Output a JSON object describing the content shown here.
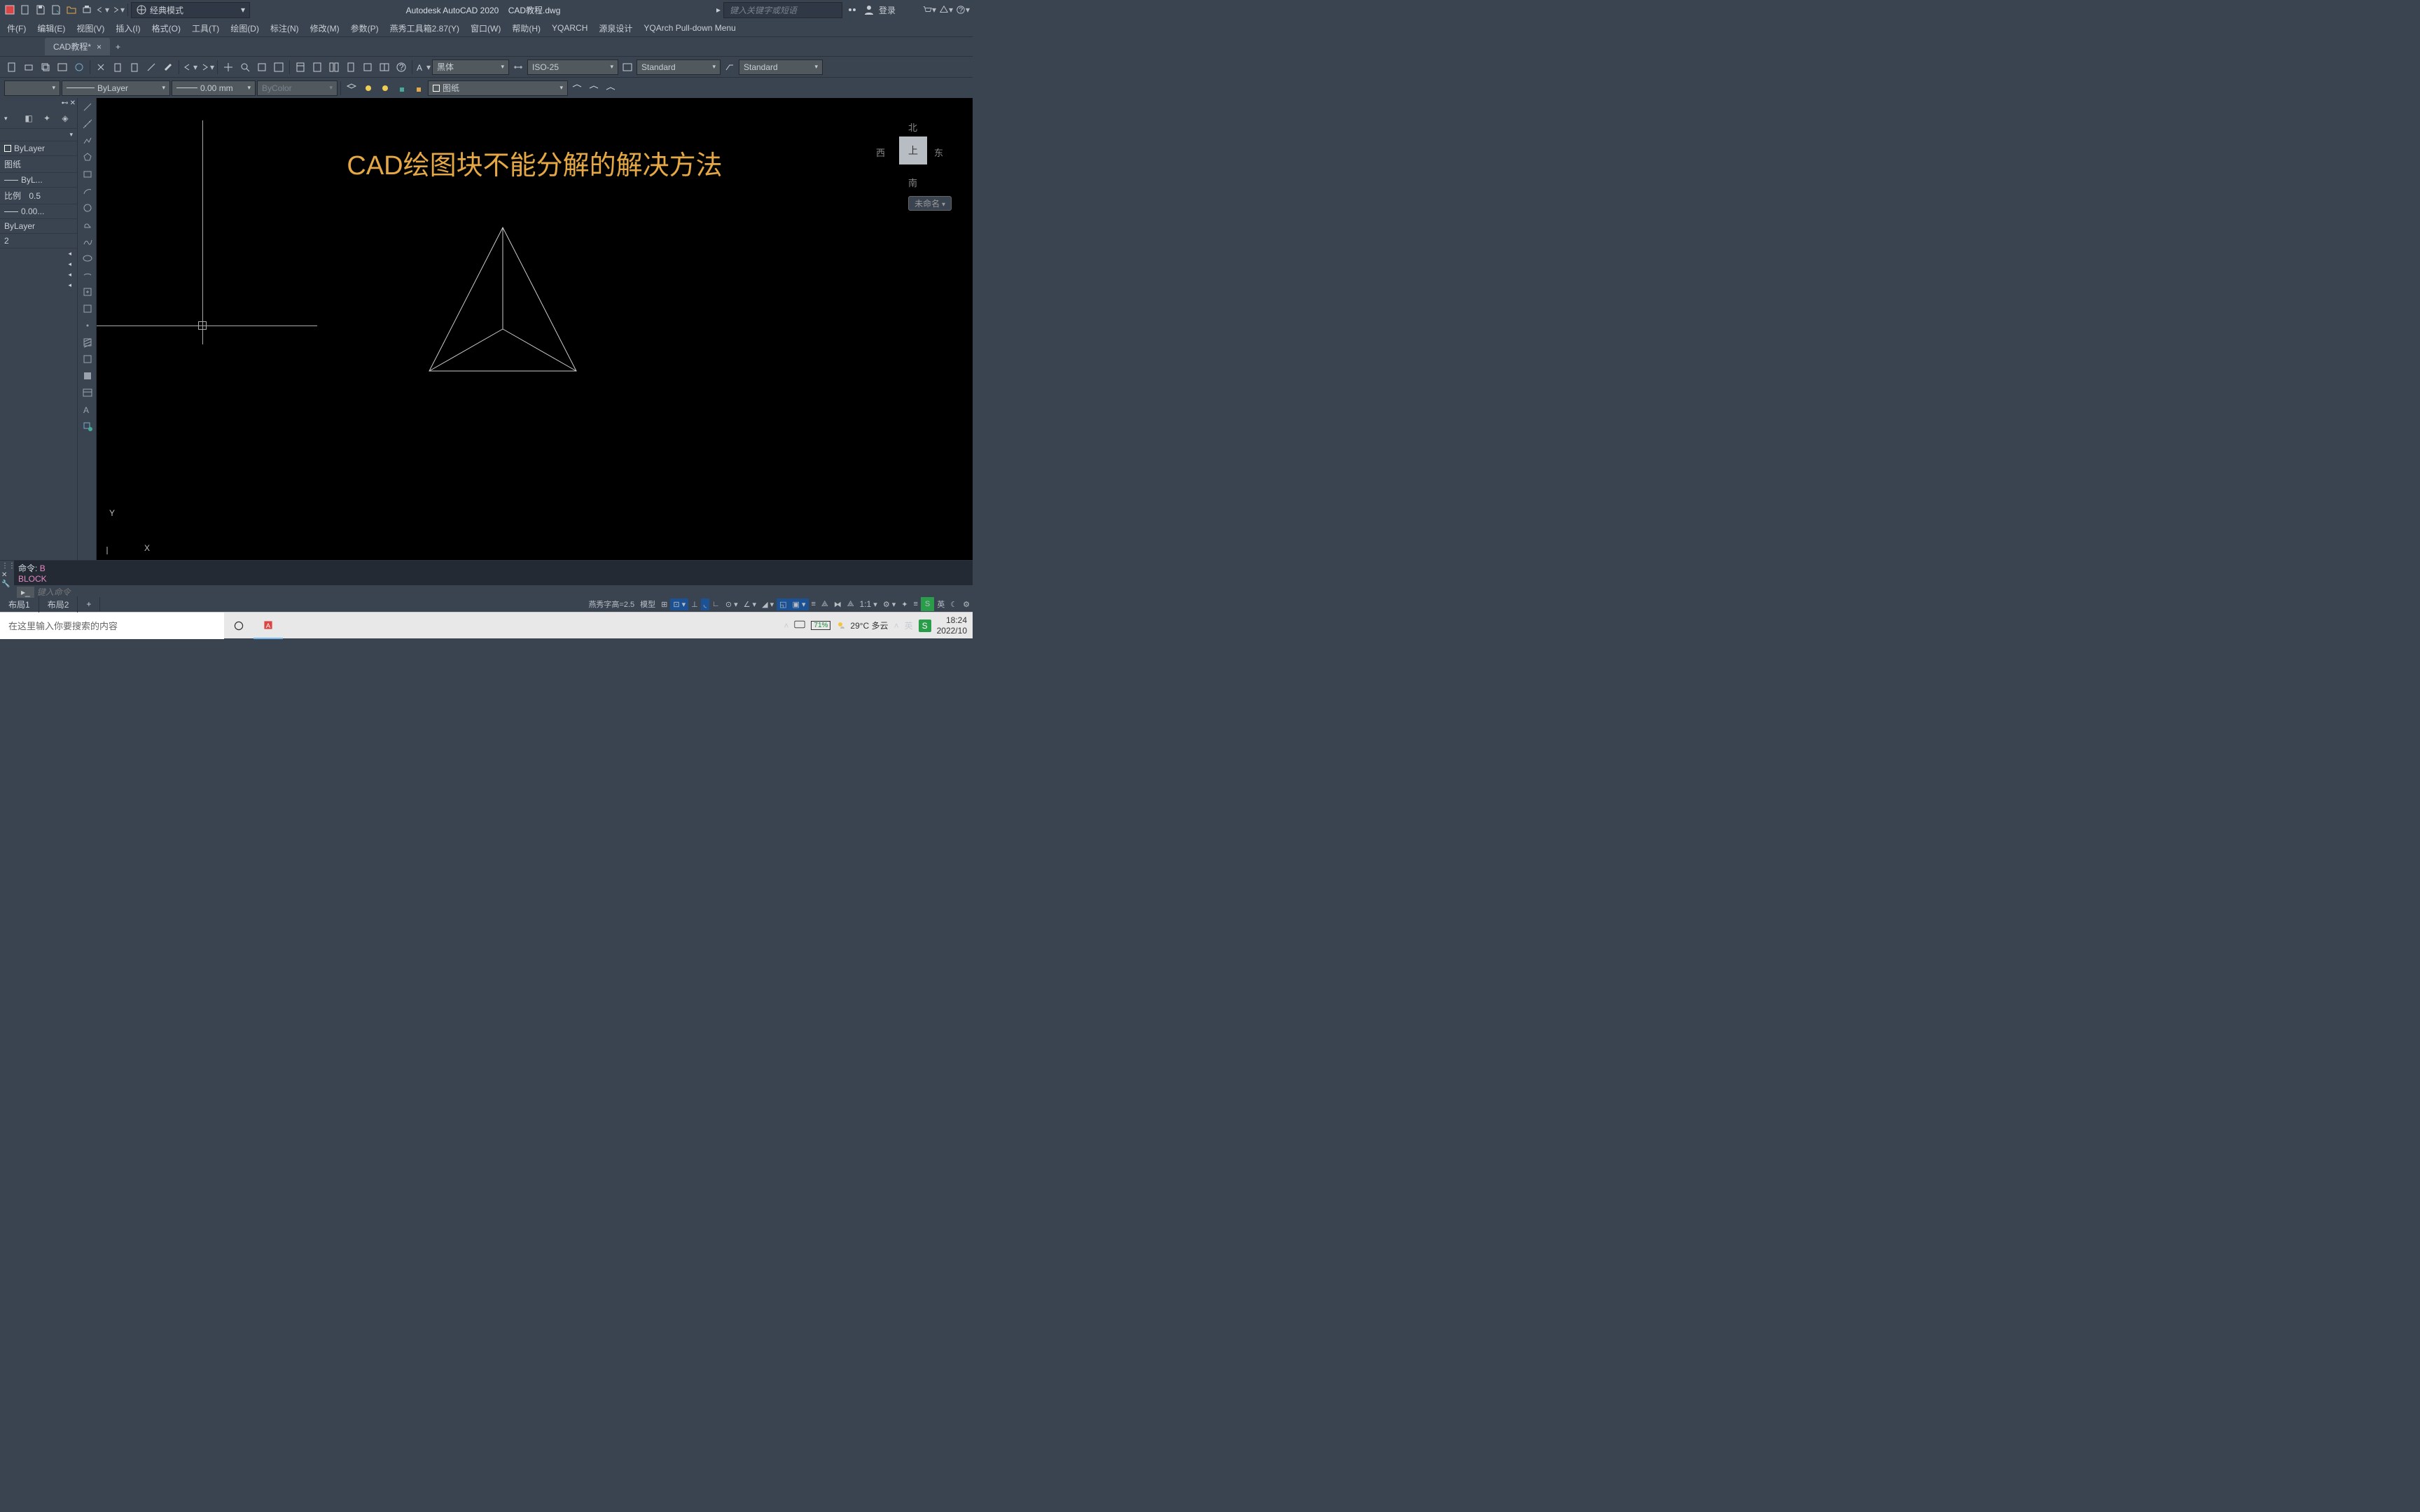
{
  "title": {
    "app": "Autodesk AutoCAD 2020",
    "file": "CAD教程.dwg"
  },
  "workspace": "经典模式",
  "search_placeholder": "键入关键字或短语",
  "login": "登录",
  "menu": [
    "件(F)",
    "编辑(E)",
    "视图(V)",
    "插入(I)",
    "格式(O)",
    "工具(T)",
    "绘图(D)",
    "标注(N)",
    "修改(M)",
    "参数(P)",
    "燕秀工具箱2.87(Y)",
    "窗口(W)",
    "帮助(H)",
    "YQARCH",
    "源泉设计",
    "YQArch Pull-down Menu"
  ],
  "tab": {
    "name": "CAD教程*"
  },
  "combos": {
    "font": "黑体",
    "dim": "ISO-25",
    "style1": "Standard",
    "style2": "Standard",
    "layer": "ByLayer",
    "lineweight": "0.00 mm",
    "color": "ByColor",
    "layer2": "图纸"
  },
  "props": {
    "bylayer": "ByLayer",
    "layer": "图纸",
    "byl": "ByL...",
    "scale": "0.5",
    "lw": "0.00...",
    "pl": "ByLayer",
    "num": "2"
  },
  "canvas": {
    "title": "CAD绘图块不能分解的解决方法",
    "ucs_x": "X",
    "ucs_y": "Y",
    "viewcube": {
      "n": "北",
      "s": "南",
      "e": "东",
      "w": "西",
      "top": "上",
      "badge": "未命名"
    }
  },
  "command": {
    "line1": "命令:",
    "cmd": "B",
    "block": "BLOCK",
    "placeholder": "键入命令"
  },
  "layouts": [
    "布局1",
    "布局2"
  ],
  "status": {
    "left": "燕秀字高=2.5",
    "model": "模型",
    "ratio": "1:1"
  },
  "taskbar": {
    "search": "在这里输入你要搜索的内容",
    "weather": "29°C 多云",
    "battery": "71%",
    "ime1": "英",
    "ime2": "英",
    "time": "18:24",
    "date": "2022/10"
  },
  "scale_prefix": "比例"
}
